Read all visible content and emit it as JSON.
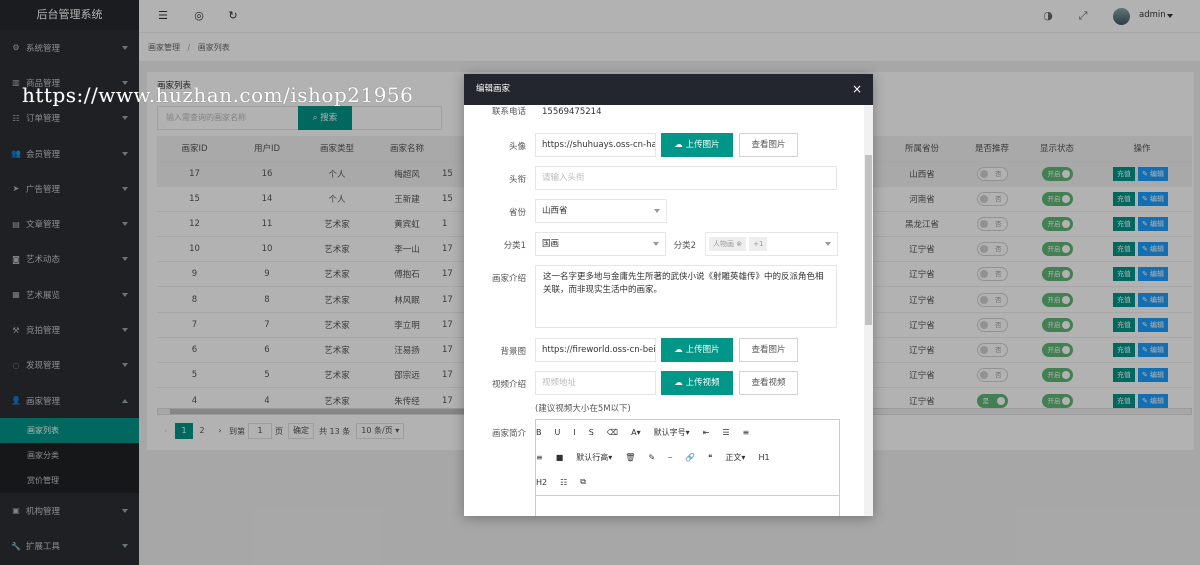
{
  "app_title": "后台管理系统",
  "sidebar": {
    "items": [
      {
        "label": "系统管理",
        "icon": "gear-icon"
      },
      {
        "label": "商品管理",
        "icon": "chart-icon"
      },
      {
        "label": "订单管理",
        "icon": "list-icon"
      },
      {
        "label": "会员管理",
        "icon": "users-icon"
      },
      {
        "label": "广告管理",
        "icon": "send-icon"
      },
      {
        "label": "文章管理",
        "icon": "file-icon"
      },
      {
        "label": "艺术动态",
        "icon": "camera-icon"
      },
      {
        "label": "艺术展览",
        "icon": "book-icon"
      },
      {
        "label": "竞拍管理",
        "icon": "gavel-icon"
      },
      {
        "label": "发现管理",
        "icon": "compass-icon"
      },
      {
        "label": "画家管理",
        "icon": "user-icon"
      }
    ],
    "sub_items": [
      "画家列表",
      "画家分类",
      "赏价管理"
    ],
    "bottom_items": [
      {
        "label": "机构管理",
        "icon": "building-icon"
      },
      {
        "label": "扩展工具",
        "icon": "wrench-icon"
      }
    ]
  },
  "topbar": {
    "user": "admin"
  },
  "breadcrumb": {
    "parent": "画家管理",
    "sep": "/",
    "current": "画家列表"
  },
  "panel": {
    "title": "画家列表",
    "search_placeholder": "输入需查询的画家名称",
    "search_button": "搜索"
  },
  "table": {
    "headers_left": [
      "画家ID",
      "用户ID",
      "画家类型",
      "画家名称"
    ],
    "headers_right": [
      "所属省份",
      "是否推荐",
      "显示状态",
      "操作"
    ],
    "rows": [
      {
        "id": "17",
        "uid": "16",
        "type": "个人",
        "name": "梅超风",
        "c5": "15",
        "province": "山西省",
        "recommend": "否",
        "rec_on": false,
        "status": "开启"
      },
      {
        "id": "15",
        "uid": "14",
        "type": "个人",
        "name": "王新建",
        "c5": "15",
        "province": "河南省",
        "recommend": "否",
        "rec_on": false,
        "status": "开启"
      },
      {
        "id": "12",
        "uid": "11",
        "type": "艺术家",
        "name": "黄宾虹",
        "c5": "1",
        "province": "黑龙江省",
        "recommend": "否",
        "rec_on": false,
        "status": "开启"
      },
      {
        "id": "10",
        "uid": "10",
        "type": "艺术家",
        "name": "李一山",
        "c5": "17",
        "province": "辽宁省",
        "recommend": "否",
        "rec_on": false,
        "status": "开启"
      },
      {
        "id": "9",
        "uid": "9",
        "type": "艺术家",
        "name": "傅抱石",
        "c5": "17",
        "province": "辽宁省",
        "recommend": "否",
        "rec_on": false,
        "status": "开启"
      },
      {
        "id": "8",
        "uid": "8",
        "type": "艺术家",
        "name": "林风眠",
        "c5": "17",
        "province": "辽宁省",
        "recommend": "否",
        "rec_on": false,
        "status": "开启"
      },
      {
        "id": "7",
        "uid": "7",
        "type": "艺术家",
        "name": "李立明",
        "c5": "17",
        "province": "辽宁省",
        "recommend": "否",
        "rec_on": false,
        "status": "开启"
      },
      {
        "id": "6",
        "uid": "6",
        "type": "艺术家",
        "name": "汪易扬",
        "c5": "17",
        "province": "辽宁省",
        "recommend": "否",
        "rec_on": false,
        "status": "开启"
      },
      {
        "id": "5",
        "uid": "5",
        "type": "艺术家",
        "name": "邵宗远",
        "c5": "17",
        "province": "辽宁省",
        "recommend": "否",
        "rec_on": false,
        "status": "开启"
      },
      {
        "id": "4",
        "uid": "4",
        "type": "艺术家",
        "name": "朱传经",
        "c5": "17",
        "province": "辽宁省",
        "recommend": "是",
        "rec_on": true,
        "status": "开启"
      }
    ],
    "action_recharge": "充值",
    "action_edit": "编辑"
  },
  "pager": {
    "pages": [
      "1",
      "2"
    ],
    "goto": "到第",
    "goto_value": "1",
    "page_unit": "页",
    "confirm": "确定",
    "total": "共 13 条",
    "per_page": "10 条/页"
  },
  "modal": {
    "title": "编辑画家",
    "phone_label": "联系电话",
    "phone_value": "15569475214",
    "avatar_label": "头像",
    "avatar_value": "https://shuhuays.oss-cn-hang",
    "upload_image": "上传图片",
    "view_image": "查看图片",
    "title_label": "头衔",
    "title_placeholder": "请输入头衔",
    "province_label": "省份",
    "province_value": "山西省",
    "cat1_label": "分类1",
    "cat1_value": "国画",
    "cat2_label": "分类2",
    "cat2_tag": "人物画",
    "cat2_more": "+1",
    "intro_label": "画家介绍",
    "intro_value": "这一名字更多地与金庸先生所著的武侠小说《射雕英雄传》中的反派角色相关联，而非现实生活中的画家。",
    "bg_label": "背景图",
    "bg_value": "https://fireworld.oss-cn-beijin",
    "video_label": "视频介绍",
    "video_placeholder": "视频地址",
    "upload_video": "上传视频",
    "view_video": "查看视频",
    "video_hint": "(建议视频大小在5M以下)",
    "brief_label": "画家简介",
    "editor_toolbar_1": [
      "B",
      "U",
      "I",
      "S",
      "⌫",
      "A▾",
      "默认字号▾",
      "⇤",
      "☰",
      "≡"
    ],
    "editor_toolbar_2": [
      "≡",
      "■",
      "默认行高▾",
      "🗑",
      "✎",
      "⎯",
      "🔗",
      "❝",
      "正文▾",
      "H1"
    ],
    "editor_toolbar_3": [
      "H2",
      "☷",
      "⧉"
    ]
  },
  "watermark": "https://www.huzhan.com/ishop21956"
}
